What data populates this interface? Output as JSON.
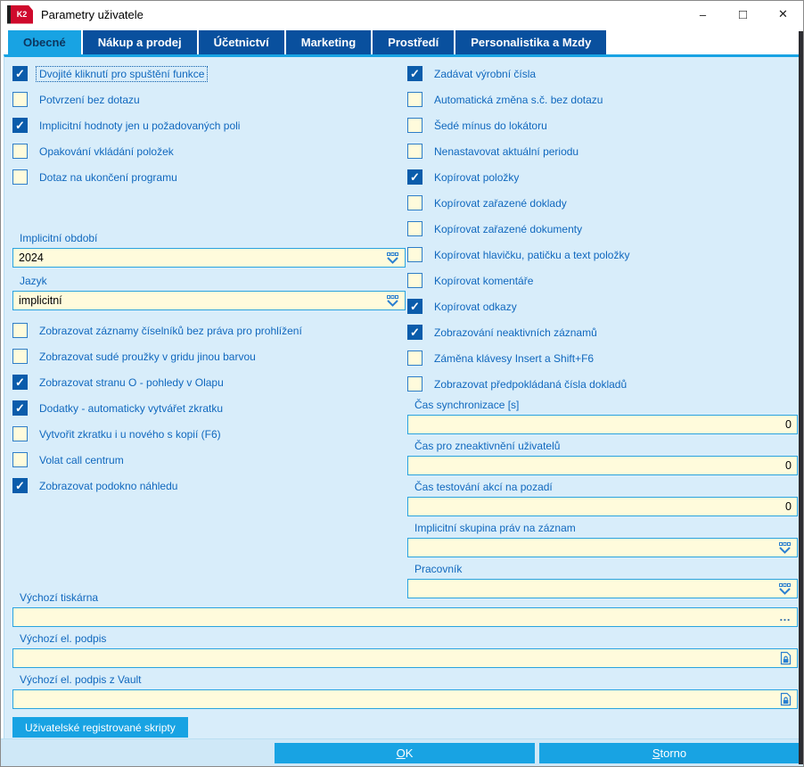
{
  "window": {
    "logo_text": "K2",
    "title": "Parametry uživatele",
    "controls": {
      "minimize": "–",
      "maximize": "□",
      "close": "✕"
    }
  },
  "tabs": [
    {
      "label": "Obecné",
      "active": true
    },
    {
      "label": "Nákup a prodej",
      "active": false
    },
    {
      "label": "Účetnictví",
      "active": false
    },
    {
      "label": "Marketing",
      "active": false
    },
    {
      "label": "Prostředí",
      "active": false
    },
    {
      "label": "Personalistika a Mzdy",
      "active": false
    }
  ],
  "panel": {
    "left": {
      "checkboxes_top": [
        {
          "label": "Dvojité kliknutí pro spuštění funkce",
          "checked": true,
          "focused": true
        },
        {
          "label": "Potvrzení bez dotazu",
          "checked": false
        },
        {
          "label": "Implicitní hodnoty jen u požadovaných poli",
          "checked": true
        },
        {
          "label": "Opakování vkládání položek",
          "checked": false
        },
        {
          "label": "Dotaz na ukončení programu",
          "checked": false
        }
      ],
      "fields": [
        {
          "label": "Implicitní období",
          "value": "2024",
          "control": "dropdown"
        },
        {
          "label": "Jazyk",
          "value": "implicitní",
          "control": "dropdown"
        }
      ],
      "checkboxes_more": [
        {
          "label": "Zobrazovat záznamy číselníků bez práva pro prohlížení",
          "checked": false
        },
        {
          "label": "Zobrazovat sudé proužky v gridu jinou barvou",
          "checked": false
        },
        {
          "label": "Zobrazovat stranu O - pohledy v Olapu",
          "checked": true
        },
        {
          "label": "Dodatky - automaticky vytvářet zkratku",
          "checked": true
        },
        {
          "label": "Vytvořit zkratku i u nového s kopií (F6)",
          "checked": false
        },
        {
          "label": "Volat call centrum",
          "checked": false
        },
        {
          "label": "Zobrazovat podokno náhledu",
          "checked": true
        }
      ]
    },
    "right": {
      "checkboxes": [
        {
          "label": "Zadávat výrobní čísla",
          "checked": true
        },
        {
          "label": "Automatická změna s.č. bez dotazu",
          "checked": false
        },
        {
          "label": "Šedé mínus do lokátoru",
          "checked": false
        },
        {
          "label": "Nenastavovat aktuální periodu",
          "checked": false
        },
        {
          "label": "Kopírovat položky",
          "checked": true
        },
        {
          "label": "Kopírovat zařazené doklady",
          "checked": false
        },
        {
          "label": "Kopírovat zařazené dokumenty",
          "checked": false
        },
        {
          "label": "Kopírovat hlavičku, patičku a text položky",
          "checked": false
        },
        {
          "label": "Kopírovat komentáře",
          "checked": false
        },
        {
          "label": "Kopírovat odkazy",
          "checked": true
        },
        {
          "label": "Zobrazování neaktivních záznamů",
          "checked": true
        },
        {
          "label": "Záměna klávesy Insert a Shift+F6",
          "checked": false
        },
        {
          "label": "Zobrazovat předpokládaná čísla dokladů",
          "checked": false
        }
      ],
      "fields": [
        {
          "label": "Čas synchronizace [s]",
          "value": "0",
          "control": "number"
        },
        {
          "label": "Čas pro zneaktivnění uživatelů",
          "value": "0",
          "control": "number"
        },
        {
          "label": "Čas testování akcí na pozadí",
          "value": "0",
          "control": "number"
        },
        {
          "label": "Implicitní skupina práv na záznam",
          "value": "",
          "control": "dropdown"
        },
        {
          "label": "Pracovník",
          "value": "",
          "control": "dropdown"
        }
      ]
    },
    "bottom": {
      "fields": [
        {
          "label": "Výchozí tiskárna",
          "value": "",
          "control": "ellipsis"
        },
        {
          "label": "Výchozí el. podpis",
          "value": "",
          "control": "signature"
        },
        {
          "label": "Výchozí el. podpis z Vault",
          "value": "",
          "control": "signature"
        }
      ],
      "scripts_button_label": "Uživatelské registrované skripty"
    }
  },
  "footer": {
    "ok_label": "OK",
    "cancel_label": "Storno"
  },
  "colors": {
    "accent_cyan": "#18a3e3",
    "tab_navy": "#09509e",
    "checkbox_checked": "#0a5cab",
    "label_blue": "#1068be",
    "field_bg": "#fffbdc",
    "field_border": "#29a3e0",
    "content_bg": "#d8edfa",
    "footer_bg": "#cfe8f7",
    "logo_red": "#cf0a2c"
  }
}
